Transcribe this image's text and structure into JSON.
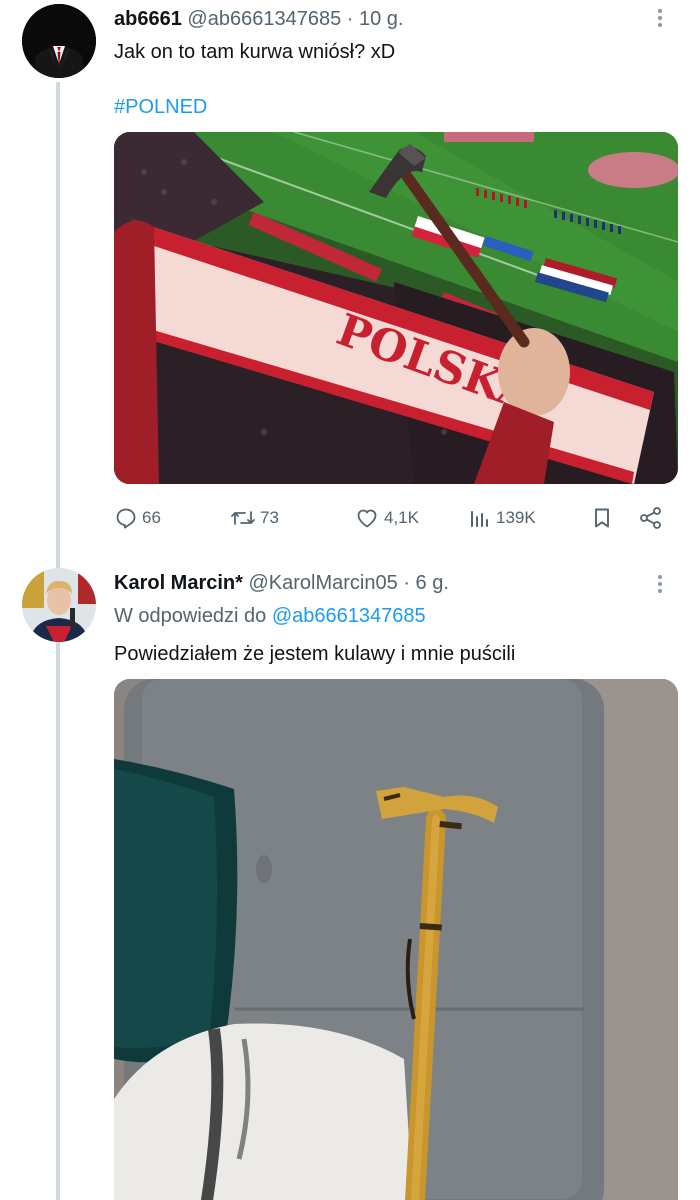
{
  "tweet1": {
    "display_name": "ab6661",
    "handle": "@ab6661347685",
    "separator": "·",
    "time": "10 g.",
    "text": "Jak on to tam kurwa wniósł? xD",
    "hashtag": "#POLNED",
    "stats": {
      "replies": "66",
      "retweets": "73",
      "likes": "4,1K",
      "views": "139K"
    }
  },
  "tweet2": {
    "display_name": "Karol Marcin*",
    "handle": "@KarolMarcin05",
    "separator": "·",
    "time": "6 g.",
    "reply_prefix": "W odpowiedzi do",
    "reply_mention": "@ab6661347685",
    "text": "Powiedziałem że jestem kulawy i mnie puścili"
  },
  "colors": {
    "link": "#1d9bf0",
    "secondary_text": "#536471",
    "thread_line": "#cfd9de",
    "primary_text": "#0f1419"
  },
  "icons": [
    "reply-icon",
    "retweet-icon",
    "like-icon",
    "views-icon",
    "bookmark-icon",
    "share-icon",
    "more-icon"
  ]
}
